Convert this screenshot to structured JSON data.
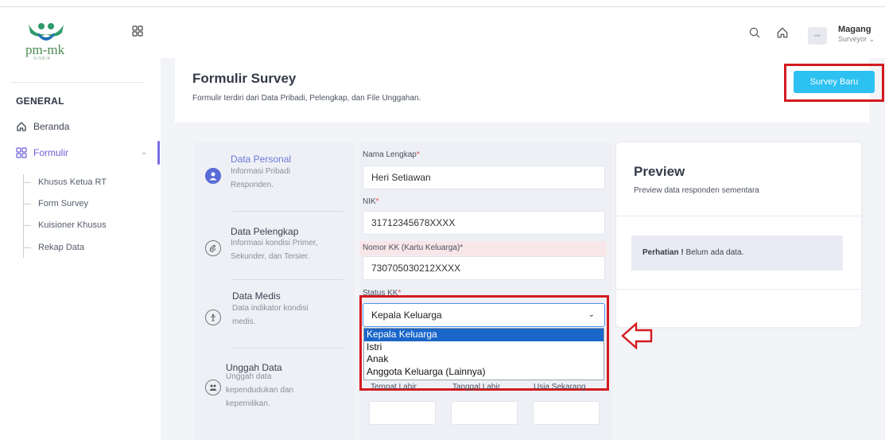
{
  "brand": {
    "name": "pm-mk",
    "subtext": "SISBIK"
  },
  "sidebar": {
    "section": "GENERAL",
    "items": [
      {
        "label": "Beranda",
        "icon": "home-icon"
      },
      {
        "label": "Formulir",
        "icon": "grid-icon",
        "active": true
      }
    ],
    "subitems": [
      "Khusus Ketua RT",
      "Form Survey",
      "Kuisioner Khusus",
      "Rekap Data"
    ]
  },
  "header": {
    "user_name": "Magang",
    "user_role": "Surveyor",
    "avatar_text": "IMG"
  },
  "page": {
    "title": "Formulir Survey",
    "subtitle": "Formulir terdiri dari Data Pribadi, Pelengkap, dan File Unggahan.",
    "new_button": "Survey Baru"
  },
  "steps": [
    {
      "title": "Data Personal",
      "desc1": "Informasi Pribadi",
      "desc2": "Responden.",
      "active": true
    },
    {
      "title": "Data Pelengkap",
      "desc1": "Informasi kondisi Primer,",
      "desc2": "Sekunder, dan Tersier."
    },
    {
      "title": "Data Medis",
      "desc1": "Data indikator kondisi",
      "desc2": "medis."
    },
    {
      "title": "Unggah Data",
      "desc1": "Unggah data",
      "desc2": "kependudukan dan",
      "desc3": "kepemilikan."
    }
  ],
  "form": {
    "nama_label": "Nama Lengkap",
    "nama_value": "Heri Setiawan",
    "nik_label": "NIK",
    "nik_value": "31712345678XXXX",
    "kk_label": "Nomor KK (Kartu Keluarga)",
    "kk_value": "730705030212XXXX",
    "status_label": "Status KK",
    "status_value": "Kepala Keluarga",
    "status_options": [
      "Kepala Keluarga",
      "Istri",
      "Anak",
      "Anggota Keluarga (Lainnya)"
    ],
    "tempat_label": "Tempat Lahir",
    "tanggal_label": "Tanggal Lahir",
    "usia_label": "Usia Sekarang",
    "required_mark": "*"
  },
  "preview": {
    "title": "Preview",
    "subtitle": "Preview data responden sementara",
    "alert_bold": "Perhatian !",
    "alert_text": " Belum ada data."
  },
  "colors": {
    "accent": "#2dc1f1",
    "active_nav": "#6d5fd8",
    "highlight": "#d21a1f",
    "selected_option": "#1a66c9"
  }
}
